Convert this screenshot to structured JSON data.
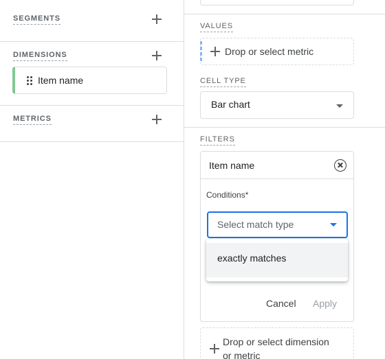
{
  "left": {
    "segments_label": "SEGMENTS",
    "dimensions_label": "DIMENSIONS",
    "dimension_item": "Item name",
    "metrics_label": "METRICS"
  },
  "right": {
    "values_label": "VALUES",
    "values_placeholder": "Drop or select metric",
    "cell_type_label": "CELL TYPE",
    "cell_type_value": "Bar chart",
    "filters_label": "FILTERS",
    "filter": {
      "dimension": "Item name",
      "conditions_label": "Conditions*",
      "match_placeholder": "Select match type",
      "menu_options": [
        "exactly matches"
      ],
      "cancel_label": "Cancel",
      "apply_label": "Apply"
    },
    "dimension_drop_line1": "Drop or select dimension",
    "dimension_drop_line2": "or metric"
  },
  "colors": {
    "accent": "#1a73e8",
    "dimension_chip_accent": "#81c995",
    "values_accent": "#8ab4f8",
    "divider": "#dadce0"
  }
}
